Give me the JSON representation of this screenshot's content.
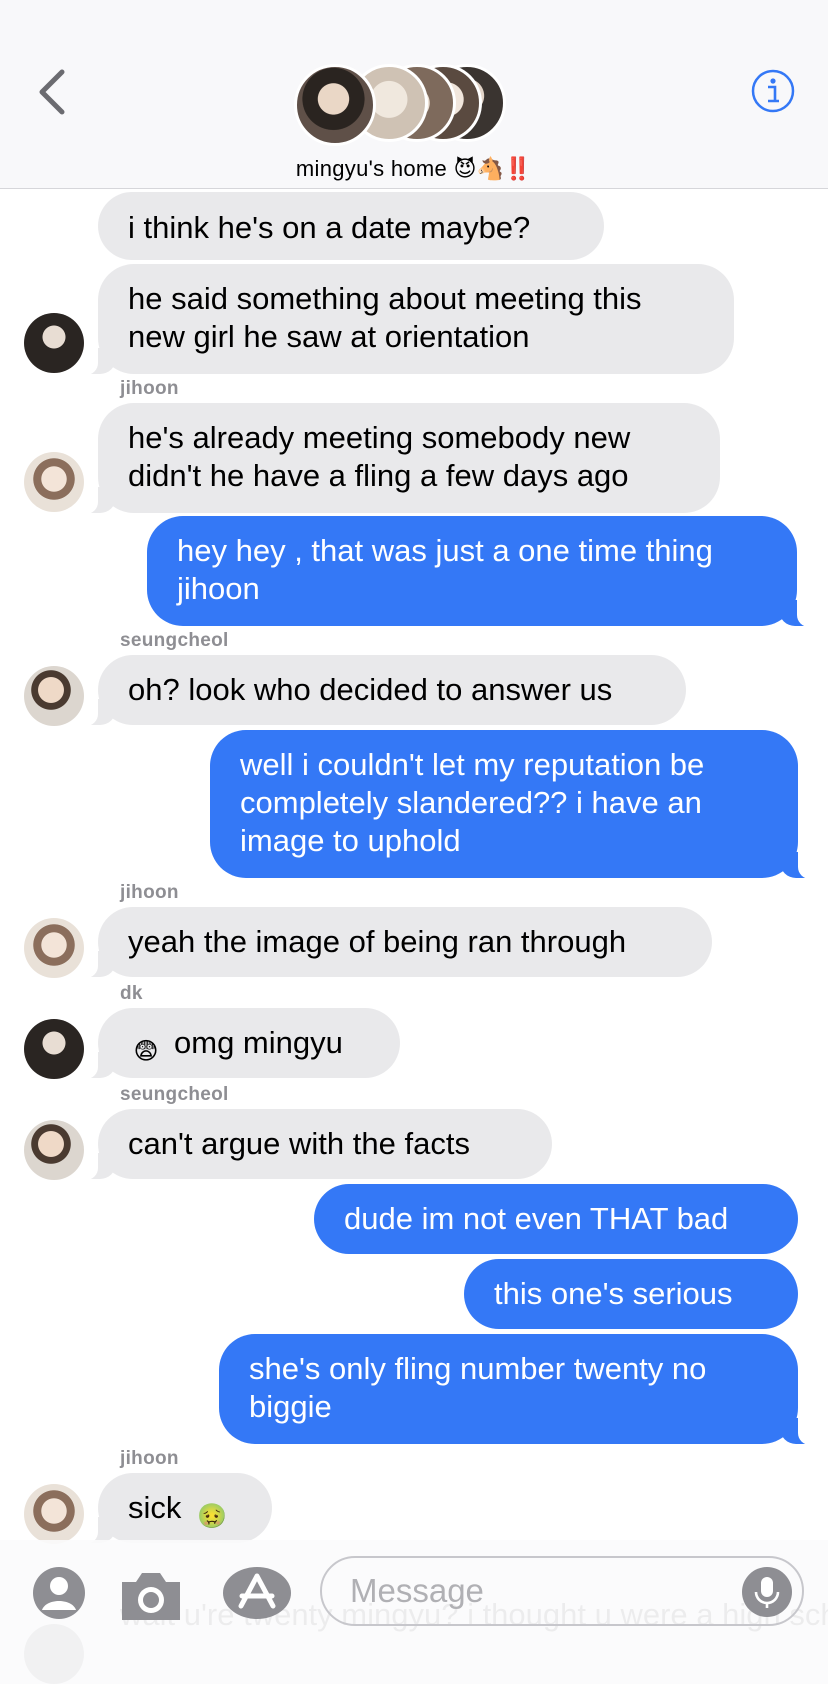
{
  "header": {
    "group_name": "mingyu's home",
    "group_emoji": "😈🐴‼️"
  },
  "messages": [
    {
      "sender": "",
      "text": "i think he's on a date maybe?"
    },
    {
      "sender": "",
      "text": "he said something about meeting this new girl he saw at orientation"
    },
    {
      "sender": "jihoon",
      "text": "he's already meeting somebody new didn't he have a fling a few days ago"
    },
    {
      "sender": "me",
      "text": "hey hey , that was just a one time thing jihoon"
    },
    {
      "sender": "seungcheol",
      "text": "oh? look who decided to answer us"
    },
    {
      "sender": "me",
      "text": "well i couldn't let my reputation be completely slandered?? i have an image to uphold"
    },
    {
      "sender": "jihoon",
      "text": "yeah the image of being ran through"
    },
    {
      "sender": "dk",
      "emoji": "😨",
      "text": "omg mingyu"
    },
    {
      "sender": "seungcheol",
      "text": "can't argue with the facts"
    },
    {
      "sender": "me",
      "text": "dude im not even THAT bad"
    },
    {
      "sender": "me",
      "text": "this one's serious"
    },
    {
      "sender": "me",
      "text": "she's only fling number twenty no biggie"
    },
    {
      "sender": "jihoon",
      "emoji": "🤢",
      "text": "sick"
    }
  ],
  "partial_message": "wait u're twenty mingyu? i thought u were a high schooler !??!??",
  "input": {
    "placeholder": "Message",
    "value": ""
  },
  "colors": {
    "sent_bubble": "#3478f6",
    "received_bubble": "#e9e9eb",
    "accent": "#3478f6"
  },
  "icons": [
    "back-chevron-icon",
    "info-icon",
    "contact-icon",
    "camera-icon",
    "app-store-icon",
    "microphone-icon"
  ]
}
